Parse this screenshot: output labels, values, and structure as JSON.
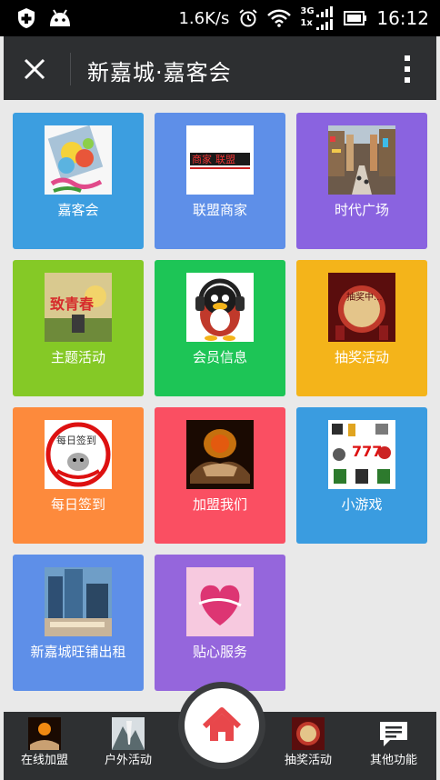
{
  "status_bar": {
    "net_speed": "1.6K/s",
    "network_top": "3G",
    "network_bottom": "1x",
    "time": "16:12"
  },
  "header": {
    "title": "新嘉城·嘉客会"
  },
  "tiles": [
    {
      "label": "嘉客会",
      "color": "#3c9ee0"
    },
    {
      "label": "联盟商家",
      "color": "#5e8fe8"
    },
    {
      "label": "时代广场",
      "color": "#8a63e0"
    },
    {
      "label": "主题活动",
      "color": "#85c926"
    },
    {
      "label": "会员信息",
      "color": "#1dc556"
    },
    {
      "label": "抽奖活动",
      "color": "#f4b41a"
    },
    {
      "label": "每日签到",
      "color": "#fd8a3c"
    },
    {
      "label": "加盟我们",
      "color": "#fa4f62"
    },
    {
      "label": "小游戏",
      "color": "#3a9ce0"
    },
    {
      "label": "新嘉城旺铺出租",
      "color": "#5e8fe8"
    },
    {
      "label": "贴心服务",
      "color": "#9566dc"
    }
  ],
  "thumb_text": {
    "shangjia_a": "商家",
    "shangjia_b": "联盟",
    "zhuti": "致青春",
    "choujiang": "抽奖中...",
    "qiandao": "每日签到"
  },
  "bottom_nav": [
    {
      "label": "在线加盟"
    },
    {
      "label": "户外活动"
    },
    {
      "label": "抽奖活动"
    },
    {
      "label": "其他功能"
    }
  ]
}
